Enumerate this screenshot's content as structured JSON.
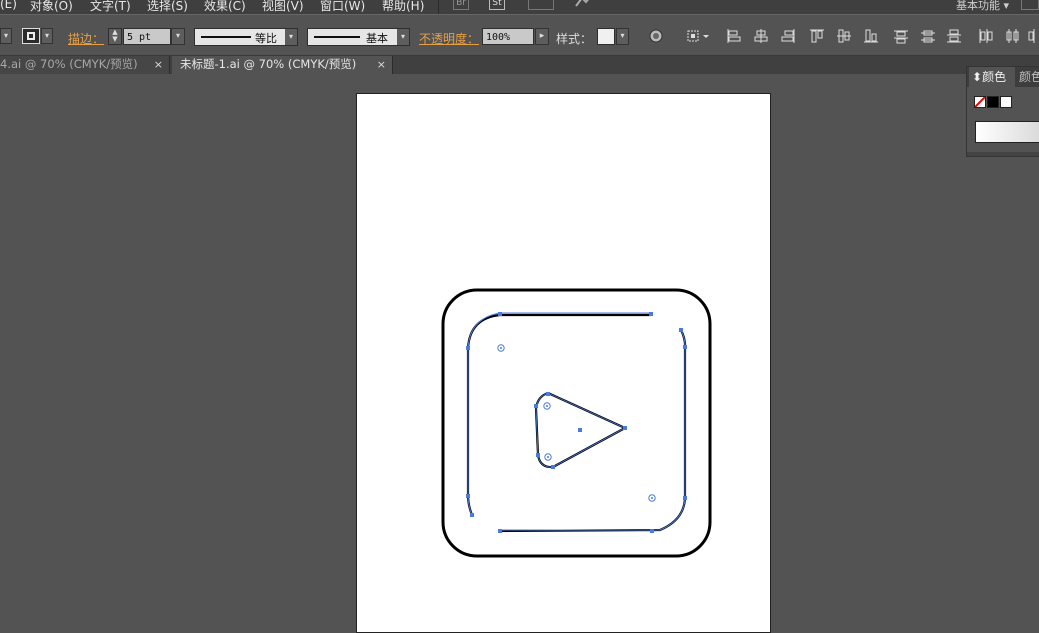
{
  "menu": {
    "items": [
      "(E)",
      "对象(O)",
      "文字(T)",
      "选择(S)",
      "效果(C)",
      "视图(V)",
      "窗口(W)",
      "帮助(H)"
    ],
    "bridge_label": "Br",
    "stock_label": "St",
    "workspace": "基本功能"
  },
  "control": {
    "stroke_label": "描边",
    "stroke_weight": "5 pt",
    "variable_width_profile": "等比",
    "brush_definition": "基本",
    "opacity_label": "不透明度",
    "opacity_value": "100%",
    "style_label": "样式"
  },
  "tabs": [
    {
      "label": "4.ai @ 70% (CMYK/预览)",
      "active": false
    },
    {
      "label": "未标题-1.ai @ 70% (CMYK/预览)",
      "active": true
    }
  ],
  "color_panel": {
    "active_tab": "颜色",
    "inactive_tab": "颜色"
  },
  "colors": {
    "accent_orange": "#e8a046",
    "selection_blue": "#4a7bdc",
    "canvas_bg": "#535353",
    "artboard": "#ffffff"
  }
}
